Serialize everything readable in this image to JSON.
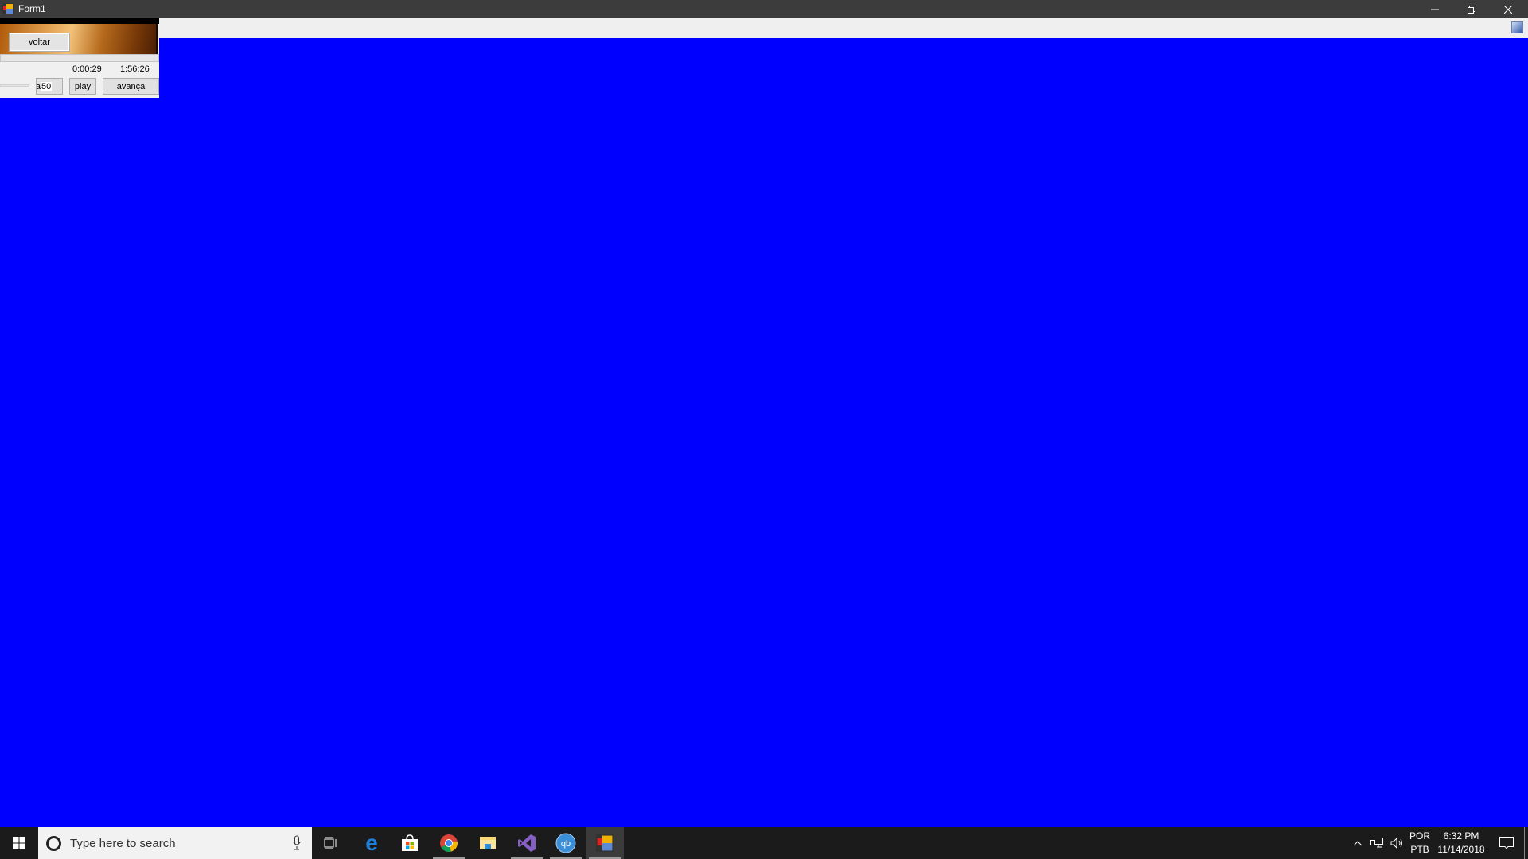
{
  "window": {
    "title": "Form1",
    "controls": {
      "minimize": "minimize-icon",
      "maximize": "restore-icon",
      "close": "close-icon"
    }
  },
  "toolstrip": {
    "icon": "picture-icon"
  },
  "player": {
    "back_label": "voltar",
    "current_time": "0:00:29",
    "total_time": "1:56:26",
    "volume_label_clip": "ta",
    "volume_value": "50",
    "play_label": "play",
    "forward_label": "avança"
  },
  "taskbar": {
    "search_placeholder": "Type here to search",
    "apps": [
      {
        "name": "task-view",
        "running": false
      },
      {
        "name": "edge",
        "running": false
      },
      {
        "name": "store",
        "running": false
      },
      {
        "name": "chrome",
        "running": true
      },
      {
        "name": "file-explorer",
        "running": false
      },
      {
        "name": "visual-studio",
        "running": true
      },
      {
        "name": "qbittorrent",
        "running": true
      },
      {
        "name": "form1-app",
        "running": true,
        "active": true
      }
    ],
    "lang_top": "POR",
    "lang_bottom": "PTB",
    "time": "6:32 PM",
    "date": "11/14/2018"
  },
  "colors": {
    "background": "#0000ff",
    "titlebar": "#3c3c3c",
    "taskbar": "#1b1b1b"
  }
}
